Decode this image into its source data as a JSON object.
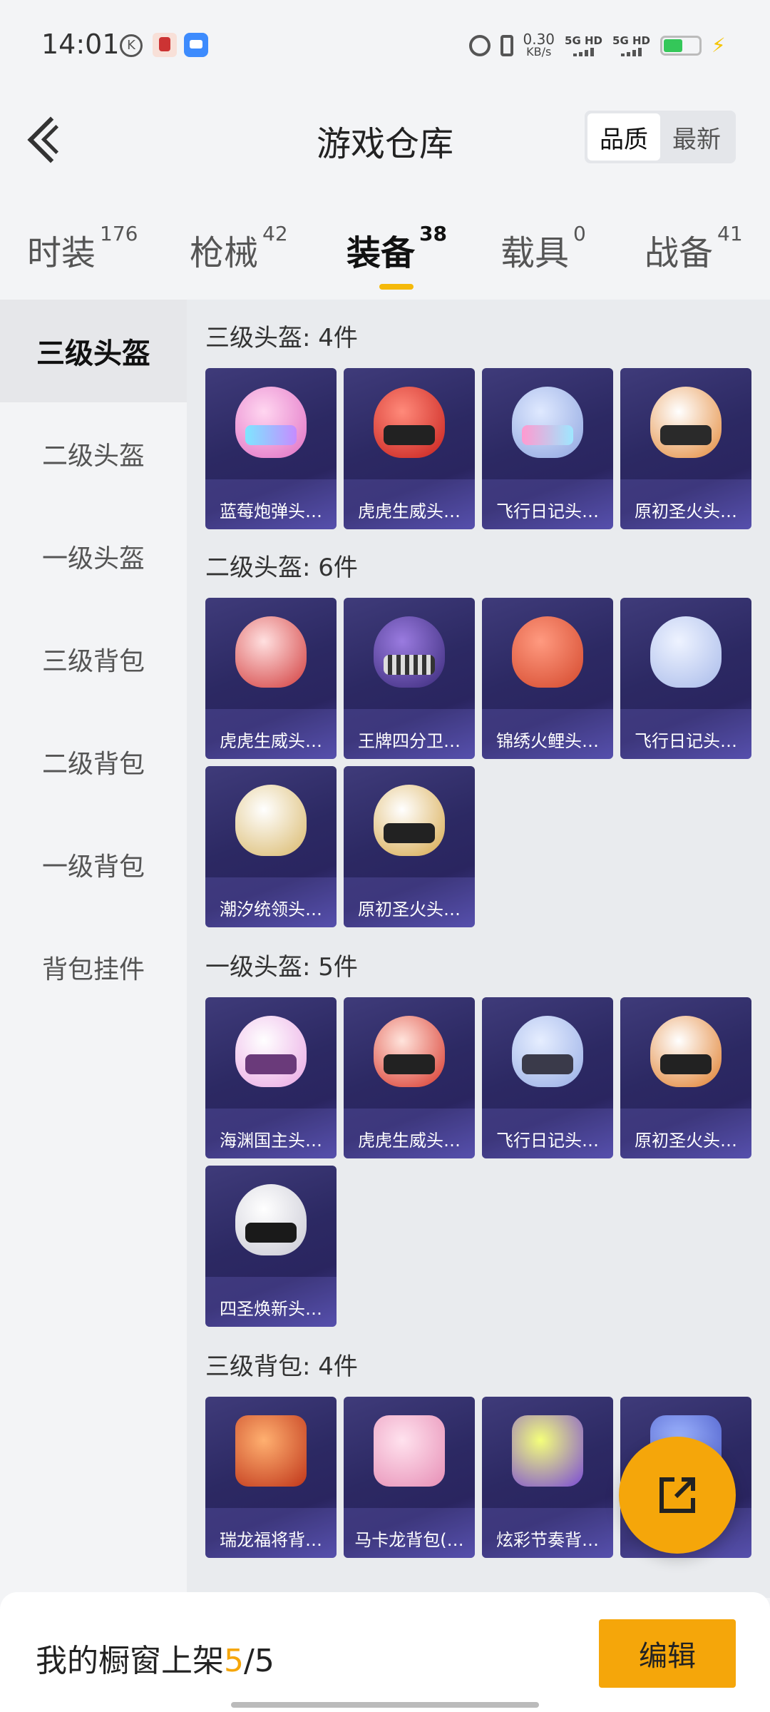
{
  "status_bar": {
    "time": "14:01",
    "net_speed_top": "0.30",
    "net_speed_unit": "KB/s",
    "sim1": "5G HD",
    "sim2": "5G HD"
  },
  "header": {
    "title": "游戏仓库",
    "sort_options": [
      "品质",
      "最新"
    ],
    "active_sort": "品质"
  },
  "tabs": [
    {
      "label": "时装",
      "count": "176"
    },
    {
      "label": "枪械",
      "count": "42"
    },
    {
      "label": "装备",
      "count": "38"
    },
    {
      "label": "载具",
      "count": "0"
    },
    {
      "label": "战备",
      "count": "41"
    }
  ],
  "sidebar": {
    "items": [
      {
        "label": "三级头盔"
      },
      {
        "label": "二级头盔"
      },
      {
        "label": "一级头盔"
      },
      {
        "label": "三级背包"
      },
      {
        "label": "二级背包"
      },
      {
        "label": "一级背包"
      },
      {
        "label": "背包挂件"
      }
    ]
  },
  "sections": [
    {
      "title": "三级头盔: 4件",
      "items": [
        "蓝莓炮弹头…",
        "虎虎生威头…",
        "飞行日记头…",
        "原初圣火头…"
      ]
    },
    {
      "title": "二级头盔: 6件",
      "items": [
        "虎虎生威头…",
        "王牌四分卫…",
        "锦绣火鲤头…",
        "飞行日记头…",
        "潮汐统领头…",
        "原初圣火头…"
      ]
    },
    {
      "title": "一级头盔: 5件",
      "items": [
        "海渊国主头…",
        "虎虎生威头…",
        "飞行日记头…",
        "原初圣火头…",
        "四圣焕新头…"
      ]
    },
    {
      "title": "三级背包: 4件",
      "items": [
        "瑞龙福将背…",
        "马卡龙背包(…",
        "炫彩节奏背…",
        ""
      ]
    }
  ],
  "bottom": {
    "shelf_label": "我的橱窗上架",
    "shelf_count": "5",
    "shelf_total": "/5",
    "edit_label": "编辑"
  },
  "colors": {
    "accent": "#f5a60a",
    "card_bg": "#2c2963"
  }
}
